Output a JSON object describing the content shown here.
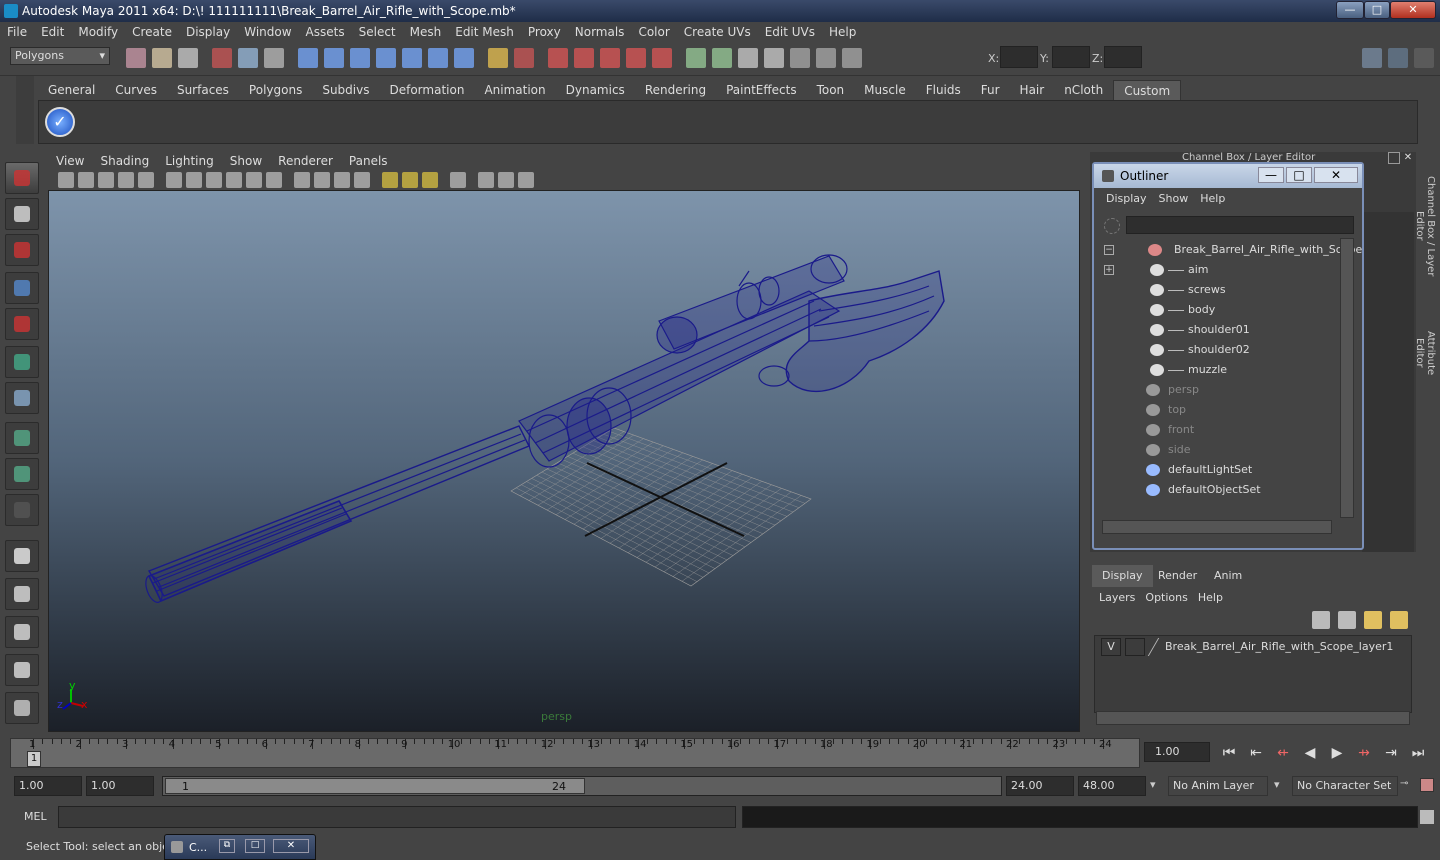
{
  "window": {
    "title": "Autodesk Maya 2011 x64: D:\\! 111111111\\Break_Barrel_Air_Rifle_with_Scope.mb*",
    "min_label": "—",
    "max_label": "□",
    "close_label": "✕"
  },
  "menubar": [
    "File",
    "Edit",
    "Modify",
    "Create",
    "Display",
    "Window",
    "Assets",
    "Select",
    "Mesh",
    "Edit Mesh",
    "Proxy",
    "Normals",
    "Color",
    "Create UVs",
    "Edit UVs",
    "Help"
  ],
  "statusline": {
    "mode": "Polygons",
    "x_label": "X:",
    "y_label": "Y:",
    "z_label": "Z:"
  },
  "shelf_tabs": [
    "General",
    "Curves",
    "Surfaces",
    "Polygons",
    "Subdivs",
    "Deformation",
    "Animation",
    "Dynamics",
    "Rendering",
    "PaintEffects",
    "Toon",
    "Muscle",
    "Fluids",
    "Fur",
    "Hair",
    "nCloth",
    "Custom"
  ],
  "shelf_active": "Custom",
  "viewport": {
    "menu": [
      "View",
      "Shading",
      "Lighting",
      "Show",
      "Renderer",
      "Panels"
    ],
    "camera_label": "persp",
    "axis_y": "y",
    "axis_x": "x",
    "axis_z": "z"
  },
  "outliner": {
    "title": "Outliner",
    "menu": [
      "Display",
      "Show",
      "Help"
    ],
    "root": "Break_Barrel_Air_Rifle_with_Scope",
    "children": [
      "aim",
      "screws",
      "body",
      "shoulder01",
      "shoulder02",
      "muzzle"
    ],
    "cameras": [
      "persp",
      "top",
      "front",
      "side"
    ],
    "sets": [
      "defaultLightSet",
      "defaultObjectSet"
    ]
  },
  "channel_box": {
    "title": "Channel Box / Layer Editor",
    "side_tab_1": "Channel Box / Layer Editor",
    "side_tab_2": "Attribute Editor"
  },
  "layers": {
    "tabs": [
      "Display",
      "Render",
      "Anim"
    ],
    "active_tab": "Display",
    "menu": [
      "Layers",
      "Options",
      "Help"
    ],
    "layer_visible": "V",
    "layer_name": "Break_Barrel_Air_Rifle_with_Scope_layer1"
  },
  "timeline": {
    "ticks": [
      "1",
      "2",
      "3",
      "4",
      "5",
      "6",
      "7",
      "8",
      "9",
      "10",
      "11",
      "12",
      "13",
      "14",
      "15",
      "16",
      "17",
      "18",
      "19",
      "20",
      "21",
      "22",
      "23",
      "24"
    ],
    "current_frame_label": "1",
    "current_time": "1.00"
  },
  "range": {
    "start": "1.00",
    "playback_start": "1.00",
    "slider_start": "1",
    "slider_end": "24",
    "playback_end": "24.00",
    "end": "48.00",
    "anim_layer": "No Anim Layer",
    "character_set": "No Character Set"
  },
  "mel": {
    "label": "MEL"
  },
  "helpline": {
    "text": "Select Tool: select an object",
    "minimized_window": "C..."
  }
}
